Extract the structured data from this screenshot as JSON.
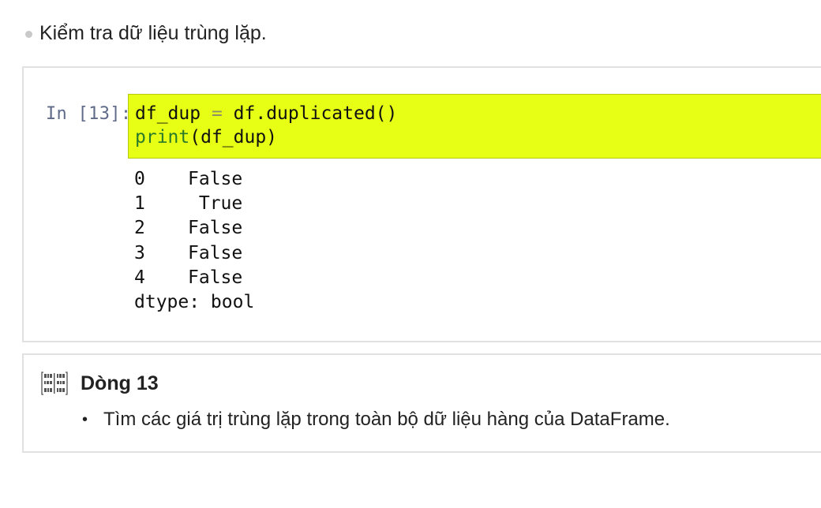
{
  "heading": {
    "text": "Kiểm tra dữ liệu trùng lặp."
  },
  "cell": {
    "prompt": "In [13]:",
    "code": {
      "line1_lhs": "df_dup",
      "line1_op": "=",
      "line1_rhs": "df.duplicated()",
      "line2_fn": "print",
      "line2_args": "(df_dup)"
    },
    "output": {
      "rows": [
        {
          "index": "0",
          "value": "False"
        },
        {
          "index": "1",
          "value": " True"
        },
        {
          "index": "2",
          "value": "False"
        },
        {
          "index": "3",
          "value": "False"
        },
        {
          "index": "4",
          "value": "False"
        }
      ],
      "dtype": "dtype: bool"
    }
  },
  "note": {
    "icon": "binary-code-icon",
    "title": "Dòng 13",
    "items": [
      "Tìm các giá trị trùng lặp trong toàn bộ dữ liệu hàng của DataFrame."
    ]
  },
  "colors": {
    "highlight": "#e6ff14",
    "prompt": "#606b8a",
    "border": "#e1e1e1"
  }
}
